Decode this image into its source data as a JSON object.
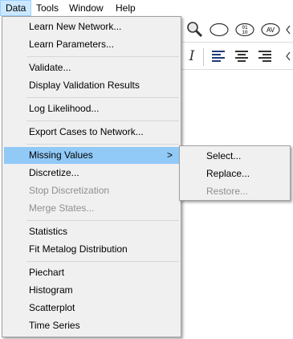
{
  "menubar": {
    "items": [
      {
        "label": "Data",
        "active": true
      },
      {
        "label": "Tools"
      },
      {
        "label": "Window"
      },
      {
        "label": "Help"
      }
    ]
  },
  "toolbar": {
    "row1_icons": [
      "magnifier-icon",
      "ellipse-node-icon",
      "binary-node-icon",
      "av-node-icon",
      "chevron-icon"
    ],
    "binary_text": "01\n10",
    "av_text": "AV",
    "row2_icons": [
      "italic-icon",
      "align-left-icon",
      "align-center-icon",
      "align-right-icon",
      "chevron-icon"
    ],
    "italic_text": "I"
  },
  "data_menu": {
    "items": [
      {
        "label": "Learn New Network..."
      },
      {
        "label": "Learn Parameters..."
      },
      {
        "label": "Validate..."
      },
      {
        "label": "Display Validation Results"
      },
      {
        "label": "Log Likelihood..."
      },
      {
        "label": "Export Cases to Network..."
      },
      {
        "label": "Missing Values",
        "highlight": true,
        "submenu": true
      },
      {
        "label": "Discretize..."
      },
      {
        "label": "Stop Discretization",
        "disabled": true
      },
      {
        "label": "Merge States...",
        "disabled": true
      },
      {
        "label": "Statistics"
      },
      {
        "label": "Fit Metalog Distribution"
      },
      {
        "label": "Piechart"
      },
      {
        "label": "Histogram"
      },
      {
        "label": "Scatterplot"
      },
      {
        "label": "Time Series"
      }
    ],
    "submenu_arrow": ">"
  },
  "missing_values_submenu": {
    "items": [
      {
        "label": "Select..."
      },
      {
        "label": "Replace..."
      },
      {
        "label": "Restore...",
        "disabled": true
      }
    ]
  },
  "colors": {
    "menu_bg": "#f0f0f0",
    "highlight": "#91c9f7",
    "menubar_active": "#cce8ff",
    "disabled_text": "#8f8f8f"
  }
}
